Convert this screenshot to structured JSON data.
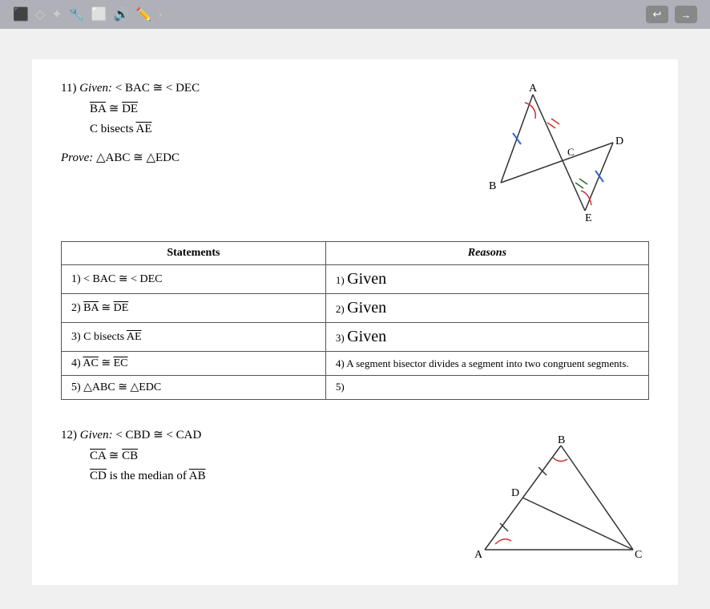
{
  "topbar": {
    "nav_back": "↩",
    "nav_fwd": "→"
  },
  "problem11": {
    "number": "11)",
    "given_label": "Given:",
    "given1": "< BAC ≅ < DEC",
    "given2_pre": "BA",
    "given2_post": " ≅ ",
    "given2_end": "DE",
    "given3_pre": "C bisects ",
    "given3_seg": "AE",
    "prove_label": "Prove:",
    "prove": "△ABC ≅ △EDC"
  },
  "table": {
    "statements_header": "Statements",
    "reasons_header": "Reasons",
    "rows": [
      {
        "statement": "1) < BAC ≅ < DEC",
        "reason_num": "1)",
        "reason_text": "Given",
        "reason_style": "handwritten"
      },
      {
        "statement_pre": "2) BA",
        "statement_post": " ≅ ",
        "statement_end": "DE",
        "reason_num": "2)",
        "reason_text": "Given",
        "reason_style": "handwritten"
      },
      {
        "statement_pre": "3) C bisects ",
        "statement_seg": "AE",
        "reason_num": "3)",
        "reason_text": "Given",
        "reason_style": "handwritten"
      },
      {
        "statement_pre": "4) AC",
        "statement_post": " ≅ ",
        "statement_end": "EC",
        "reason": "4) A segment bisector divides a segment into two congruent segments.",
        "reason_style": "normal"
      },
      {
        "statement": "5) △ABC  ≅  △EDC",
        "reason_num": "5)",
        "reason_text": "",
        "reason_style": "normal"
      }
    ]
  },
  "problem12": {
    "number": "12)",
    "given_label": "Given:",
    "given1": "< CBD ≅ < CAD",
    "given2_pre": "CA",
    "given2_post": " ≅ ",
    "given2_end": "CB",
    "given3_pre": "CD",
    "given3_post": " is the median of ",
    "given3_seg": "AB"
  },
  "diagram11": {
    "label_a": "A",
    "label_b": "B",
    "label_c": "C",
    "label_d": "D",
    "label_e": "E"
  },
  "diagram12": {
    "label_a": "A",
    "label_b": "B",
    "label_c": "C",
    "label_d": "D"
  }
}
